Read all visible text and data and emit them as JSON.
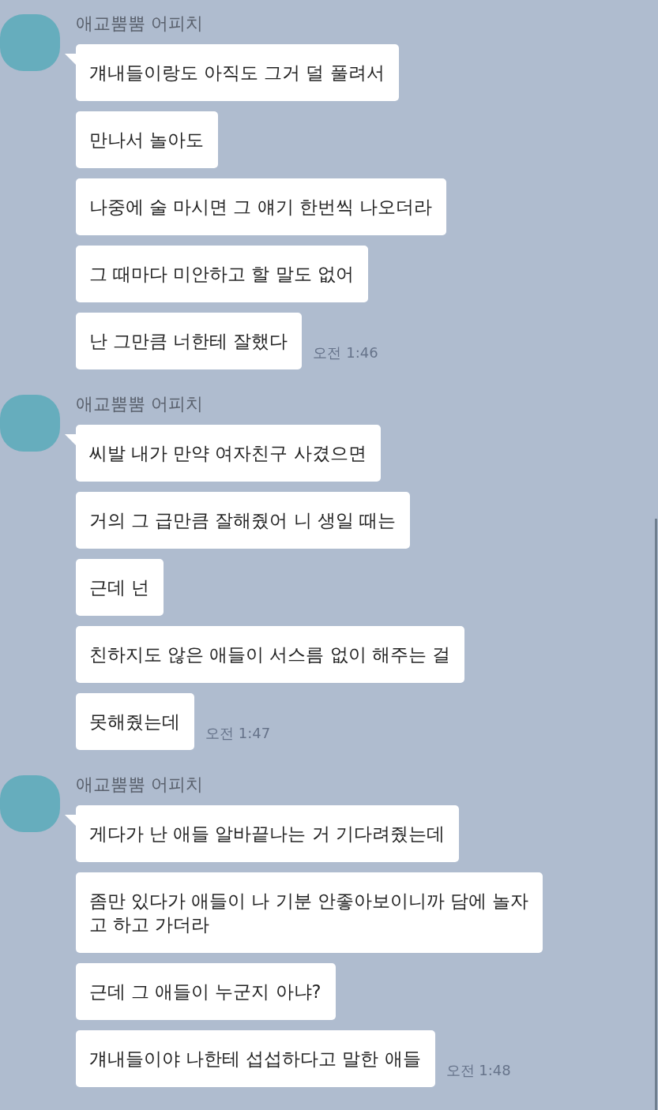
{
  "chat": {
    "groups": [
      {
        "sender": "애교뿜뿜 어피치",
        "messages": [
          "걔내들이랑도 아직도 그거 덜 풀려서",
          "만나서 놀아도",
          "나중에 술 마시면 그 얘기 한번씩 나오더라",
          "그 때마다 미안하고 할 말도 없어",
          "난 그만큼 너한테 잘했다"
        ],
        "time": "오전 1:46"
      },
      {
        "sender": "애교뿜뿜 어피치",
        "messages": [
          "씨발 내가 만약 여자친구 사겼으면",
          "거의 그 급만큼 잘해줬어 니 생일 때는",
          "근데 넌",
          "친하지도 않은 애들이 서스름 없이 해주는 걸",
          "못해줬는데"
        ],
        "time": "오전 1:47"
      },
      {
        "sender": "애교뿜뿜 어피치",
        "messages": [
          "게다가 난 애들 알바끝나는 거 기다려줬는데",
          "좀만 있다가 애들이 나 기분 안좋아보이니까 담에 놀자\n고 하고 가더라",
          "근데 그 애들이 누군지 아냐?",
          "걔내들이야 나한테 섭섭하다고 말한 애들"
        ],
        "time": "오전 1:48"
      }
    ]
  }
}
